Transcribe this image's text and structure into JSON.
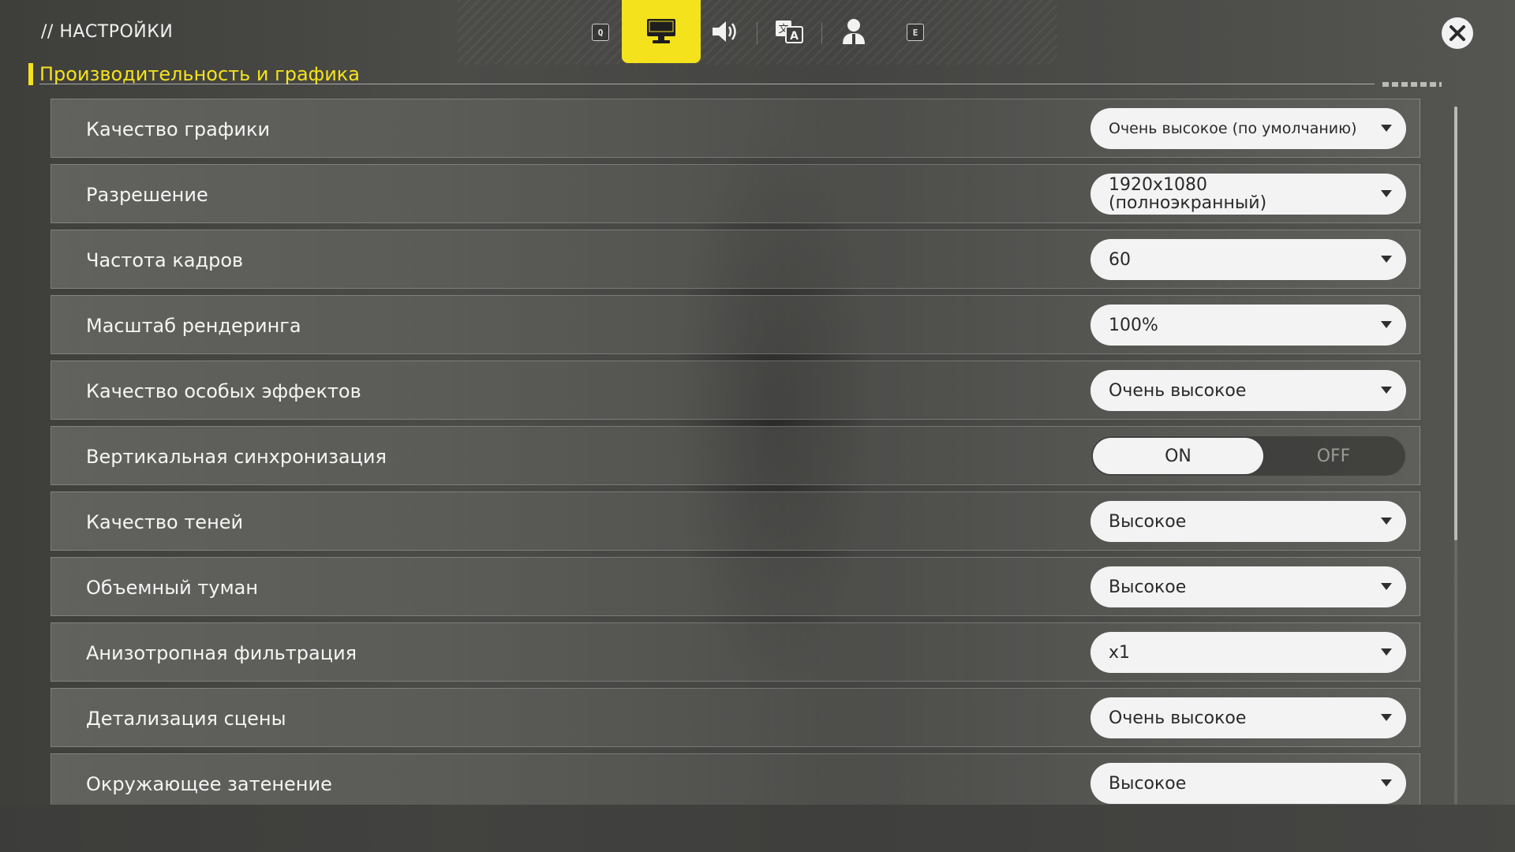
{
  "header": {
    "title": "// НАСТРОЙКИ",
    "key_left": "Q",
    "key_right": "E",
    "tabs": [
      {
        "icon": "monitor-icon",
        "active": true
      },
      {
        "icon": "speaker-icon",
        "active": false
      },
      {
        "icon": "translate-icon",
        "active": false
      },
      {
        "icon": "user-icon",
        "active": false
      }
    ],
    "close_icon": "close-icon",
    "accent_color": "#f4e21c"
  },
  "section": {
    "title": "Производительность и графика"
  },
  "settings": [
    {
      "label": "Качество графики",
      "value": "Очень высокое (по умолчанию)"
    },
    {
      "label": "Разрешение",
      "value": "1920x1080 (полноэкранный)"
    },
    {
      "label": "Частота кадров",
      "value": "60"
    },
    {
      "label": "Масштаб рендеринга",
      "value": "100%"
    },
    {
      "label": "Качество особых эффектов",
      "value": "Очень высокое"
    },
    {
      "label": "Вертикальная синхронизация",
      "toggle": true,
      "on_label": "ON",
      "off_label": "OFF",
      "selected": "ON"
    },
    {
      "label": "Качество теней",
      "value": "Высокое"
    },
    {
      "label": "Объемный туман",
      "value": "Высокое"
    },
    {
      "label": "Анизотропная фильтрация",
      "value": "x1"
    },
    {
      "label": "Детализация сцены",
      "value": "Очень высокое"
    },
    {
      "label": "Окружающее затенение",
      "value": "Высокое"
    }
  ]
}
